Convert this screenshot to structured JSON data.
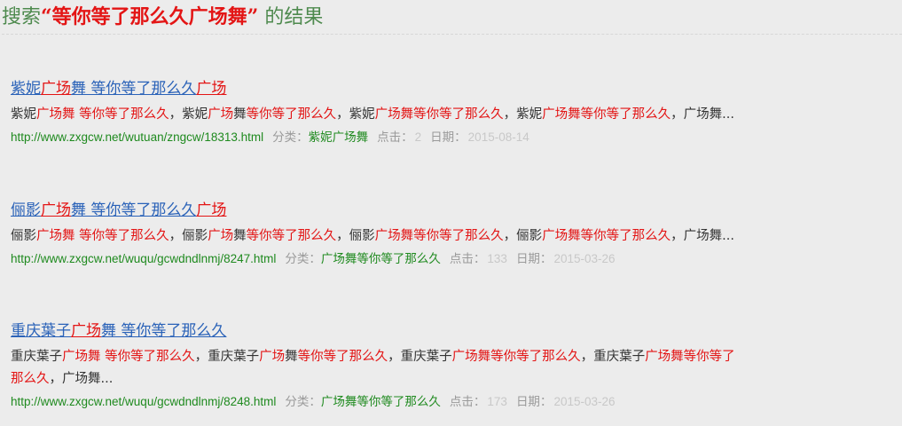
{
  "search": {
    "prefix": "搜索",
    "keyword": "“等你等了那么久广场舞”",
    "suffix": " 的结果"
  },
  "results": [
    {
      "title": {
        "a": "紫妮",
        "b": "广场",
        "c": "舞 等你等了那么久",
        "d": "广场"
      },
      "desc": {
        "a": "紫妮",
        "b": "广场舞",
        "c": " 等你等了那么久",
        "d": "，紫妮",
        "e": "广场",
        "f": "舞",
        "g": "等你等了那么久",
        "h": "，紫妮",
        "i": "广场舞",
        "j": "等你等了那么久",
        "k": "，紫妮",
        "l": "广场舞",
        "m": "等你等了那么久",
        "n": "，广场舞..."
      },
      "url": "http://www.zxgcw.net/wutuan/zngcw/18313.html",
      "category_label": "分类：",
      "category": "紫妮广场舞",
      "clicks_label": "点击：",
      "clicks": "2",
      "date_label": "日期：",
      "date": "2015-08-14"
    },
    {
      "title": {
        "a": "俪影",
        "b": "广场",
        "c": "舞 等你等了那么久",
        "d": "广场"
      },
      "desc": {
        "a": "俪影",
        "b": "广场舞",
        "c": " 等你等了那么久",
        "d": "，俪影",
        "e": "广场",
        "f": "舞",
        "g": "等你等了那么久",
        "h": "，俪影",
        "i": "广场舞",
        "j": "等你等了那么久",
        "k": "，俪影",
        "l": "广场舞",
        "m": "等你等了那么久",
        "n": "，广场舞..."
      },
      "url": "http://www.zxgcw.net/wuqu/gcwdndlnmj/8247.html",
      "category_label": "分类：",
      "category": "广场舞等你等了那么久",
      "clicks_label": "点击：",
      "clicks": "133",
      "date_label": "日期：",
      "date": "2015-03-26"
    },
    {
      "title": {
        "a": "重庆葉子",
        "b": "广场",
        "c": "舞 等你等了那么久",
        "d": ""
      },
      "desc": {
        "a": "重庆葉子",
        "b": "广场舞",
        "c": " 等你等了那么久",
        "d": "，重庆葉子",
        "e": "广场",
        "f": "舞",
        "g": "等你等了那么久",
        "h": "，重庆葉子",
        "i": "广场舞",
        "j": "等你等了那么久",
        "k": "，重庆葉子",
        "l": "广场舞",
        "m": "等你等了那么久",
        "n": "，广场舞..."
      },
      "url": "http://www.zxgcw.net/wuqu/gcwdndlnmj/8248.html",
      "category_label": "分类：",
      "category": "广场舞等你等了那么久",
      "clicks_label": "点击：",
      "clicks": "173",
      "date_label": "日期：",
      "date": "2015-03-26"
    }
  ]
}
